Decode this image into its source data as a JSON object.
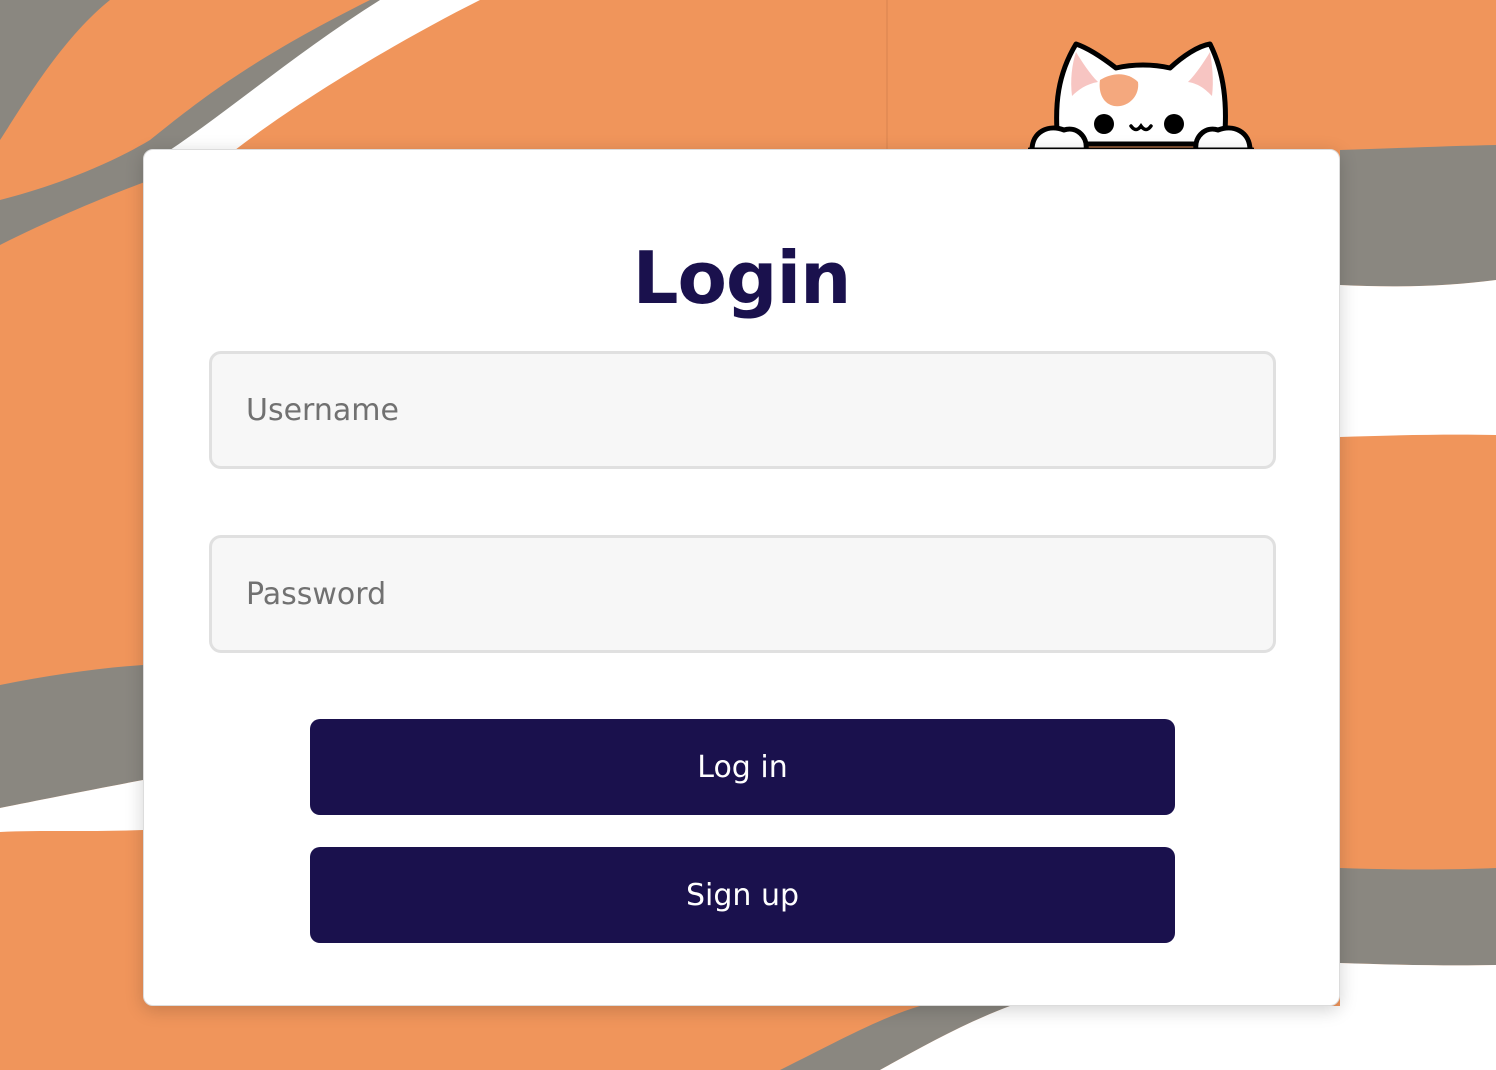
{
  "page": {
    "title": "Login"
  },
  "form": {
    "username": {
      "value": "",
      "placeholder": "Username"
    },
    "password": {
      "value": "",
      "placeholder": "Password"
    },
    "login_label": "Log in",
    "signup_label": "Sign up"
  },
  "decoration": {
    "mascot": "cat-peeking-icon"
  },
  "colors": {
    "background_orange": "#f0955b",
    "stripe_gray": "#8a8780",
    "stripe_white": "#ffffff",
    "primary_navy": "#1a114d",
    "input_bg": "#f7f7f7",
    "cat_spot": "#f4a87e",
    "cat_ear_pink": "#f7c5c2"
  }
}
